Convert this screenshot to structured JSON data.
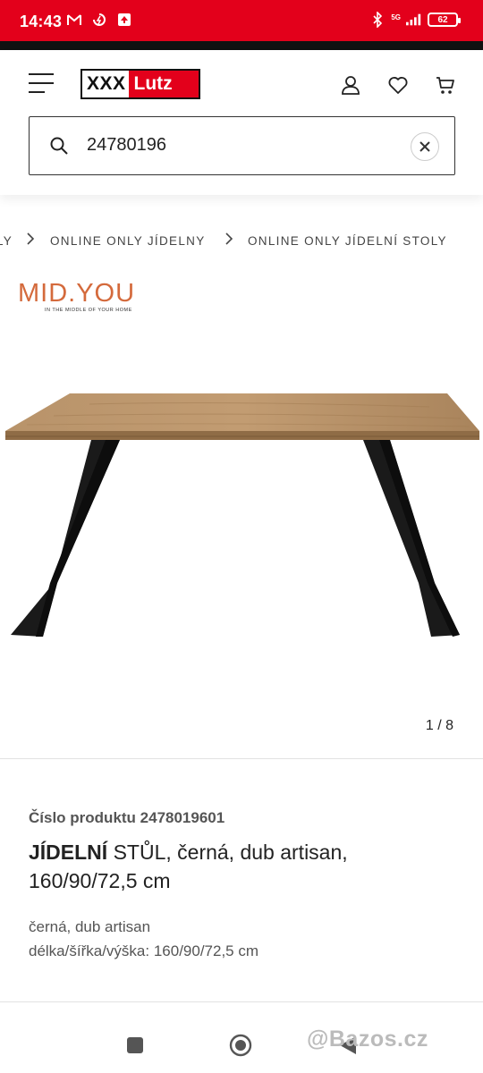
{
  "status_bar": {
    "time": "14:43",
    "network": "5G",
    "battery": "62",
    "icons_left": [
      "gmail-icon",
      "charging-fan-icon",
      "upload-icon"
    ],
    "icons_right": [
      "bluetooth-icon",
      "signal-icon",
      "battery-icon"
    ]
  },
  "header": {
    "logo_part1": "XXX",
    "logo_part2": "Lutz",
    "icons": [
      "menu-icon",
      "user-icon",
      "heart-icon",
      "cart-icon"
    ]
  },
  "search": {
    "value": "24780196",
    "icon": "search-icon",
    "clear_icon": "close-icon"
  },
  "breadcrumb": {
    "items": [
      "LY",
      "ONLINE ONLY JÍDELNY",
      "ONLINE ONLY JÍDELNÍ STOLY"
    ]
  },
  "brand": {
    "name": "MID.YOU",
    "tagline": "IN THE MIDDLE OF YOUR HOME"
  },
  "gallery": {
    "counter": "1 / 8"
  },
  "product": {
    "number_label": "Číslo produktu 2478019601",
    "title_strong": "JÍDELNÍ",
    "title_rest": " STŮL, černá, dub artisan, 160/90/72,5 cm",
    "color": "černá, dub artisan",
    "dimensions": "délka/šířka/výška: 160/90/72,5 cm"
  },
  "watermark": "@Bazos.cz",
  "colors": {
    "brand_red": "#e3001b",
    "midyou_orange": "#d46a3c",
    "table_oak": "#b08a5f",
    "table_leg": "#1a1a1a"
  }
}
